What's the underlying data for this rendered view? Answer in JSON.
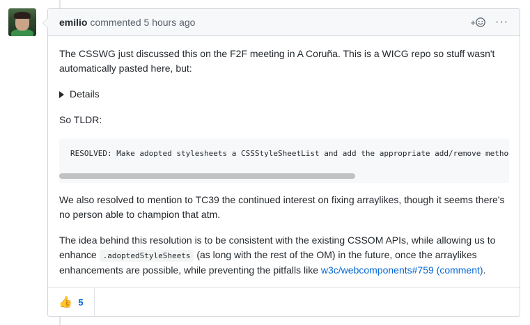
{
  "comment": {
    "author": "emilio",
    "action": "commented",
    "time": "5 hours ago",
    "para1": "The CSSWG just discussed this on the F2F meeting in A Coruña. This is a WICG repo so stuff wasn't automatically pasted here, but:",
    "details_label": "Details",
    "tldr": "So TLDR:",
    "code": "RESOLVED: Make adopted stylesheets a CSSStyleSheetList and add the appropriate add/remove methods",
    "para2": "We also resolved to mention to TC39 the continued interest on fixing arraylikes, though it seems there's no person able to champion that atm.",
    "para3_a": "The idea behind this resolution is to be consistent with the existing CSSOM APIs, while allowing us to enhance ",
    "para3_code": ".adoptedStyleSheets",
    "para3_b": " (as long with the rest of the OM) in the future, once the arraylikes enhancements are possible, while preventing the pitfalls like ",
    "para3_link": "w3c/webcomponents#759 (comment)",
    "para3_end": "."
  },
  "header": {
    "reaction_button_label": "+",
    "reaction_icon": "smiley-icon",
    "more_icon": "kebab-horizontal-icon",
    "more_label": "···"
  },
  "reactions": [
    {
      "emoji": "👍",
      "icon": "thumbs-up-icon",
      "count": "5"
    }
  ],
  "colors": {
    "link": "#0366d6",
    "border": "#d1d5da",
    "header_bg": "#f6f8fa"
  }
}
